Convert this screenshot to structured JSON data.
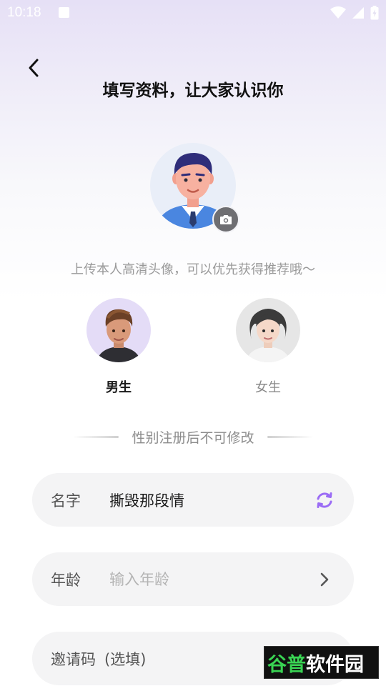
{
  "status_bar": {
    "time": "10:18"
  },
  "header": {
    "title": "填写资料，让大家认识你"
  },
  "avatar": {
    "hint": "上传本人高清头像，可以优先获得推荐哦～"
  },
  "gender": {
    "options": [
      {
        "label": "男生",
        "selected": true
      },
      {
        "label": "女生",
        "selected": false
      }
    ],
    "note": "性别注册后不可修改"
  },
  "form": {
    "name": {
      "label": "名字",
      "value": "撕毁那段情"
    },
    "age": {
      "label": "年龄",
      "placeholder": "输入年龄"
    },
    "invite": {
      "label": "邀请码",
      "suffix": "(选填)"
    }
  },
  "watermark": {
    "part1": "谷普",
    "part2": "软件园"
  },
  "colors": {
    "accent": "#9b6cf5",
    "selected_label": "#1a1a1a",
    "unselected_label": "#8a8a8a"
  }
}
